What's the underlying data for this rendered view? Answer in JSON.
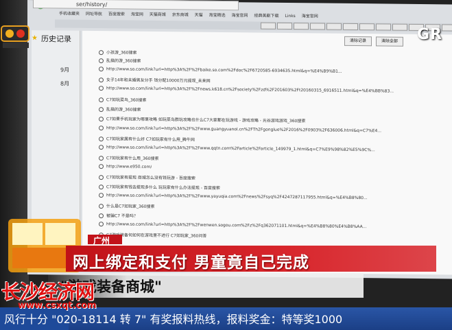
{
  "browser": {
    "url": "ser/history/",
    "bookmarks": [
      "手机收藏夹",
      "网址导航",
      "百度搜索",
      "淘宝网",
      "天猫商城",
      "京东商城",
      "天猫",
      "淘宝精选",
      "海宝官网",
      "经典美剧下载",
      "Links",
      "海宝官网"
    ],
    "page_title": "历史记录",
    "buttons": [
      "清除记录",
      "清除全部"
    ],
    "dates": [
      "9月",
      "8月"
    ],
    "rows": [
      "小孩游_360搜索",
      "乱搞的游_360搜索",
      "http://www.so.com/link?url=http%3A%2F%2Fbaike.so.com%2Fdoc%2F6720585-6934635.html&q=%E4%B9%B1...",
      "女子14年和未婚男友分手 钱分配10000万元提现_未来网",
      "http://www.so.com/link?url=http%3A%2F%2Fnews.k618.cn%2Fsociety%2Fzd%2F201603%2Ft20160315_6916511.html&q=%E4%BB%83...",
      "C7如玩菜鸟_360搜索",
      "乱搞的游_360搜索",
      "C7如果手机玩家为哪里攻略 如玩菜鸟群玩攻略也什么C7大家都在玩游戏 - 游戏攻略 - 光谷游戏游戏_360搜索",
      "http://www.so.com/link?url=http%3A%2F%2Fwww.guangyuanol.cn%2FTh2Fgonglue%2F2016%2F0903%2F636006.html&q=C7%E4...",
      "C7如玩家属有什么好 C7如玩家有什么用_腾牛网",
      "http://www.so.com/link?url=http%3A%2F%2Fwww.qqtn.com%2Farticle%2Farticle_149979_1.html&q=C7%E9%98%82%E5%9C%...",
      "C7如玩家有什么用_360搜索",
      "http://www.e950.com/",
      "C7如玩家有提现 商城怎么没有钱玩游 - 百度搜索",
      "C7如玩家有钱去提现多什么 玩玩家有什么办法提现 - 百度搜索",
      "http://www.so.com/link?url=http%3A%2F%2Fwww.yayuqia.com%2Fnews%2Fsyq%2F4247287117955.html&q=%E4%B8%80...",
      "什么是C7如玩家_360搜索",
      "被骗C7 不是吗？",
      "http://www.so.com/link?url=http%3A%2F%2Fwenwen.sogou.com%2Fz%2Fq362071101.html&q=%E4%B8%80%E4%B8%AA...",
      "C7游戏装备何如何在游戏里不进行 C7如玩家_360问答"
    ]
  },
  "overlay": {
    "channel_logo_right": "GR",
    "location": "广州",
    "headline": "网上绑定和支付 男童竟自己完成",
    "subline": "\"游戏装备商城\"",
    "watermark_text": "长沙经济网",
    "watermark_url": "www.csxqt.com",
    "ticker": "风行十分  \"020-18114 转 7\"   有奖报料热线，报料奖金：特等奖1000"
  },
  "colors": {
    "headline_red": "#c01218",
    "ticker_blue": "#1b3f86",
    "watermark_red": "#e01010"
  }
}
